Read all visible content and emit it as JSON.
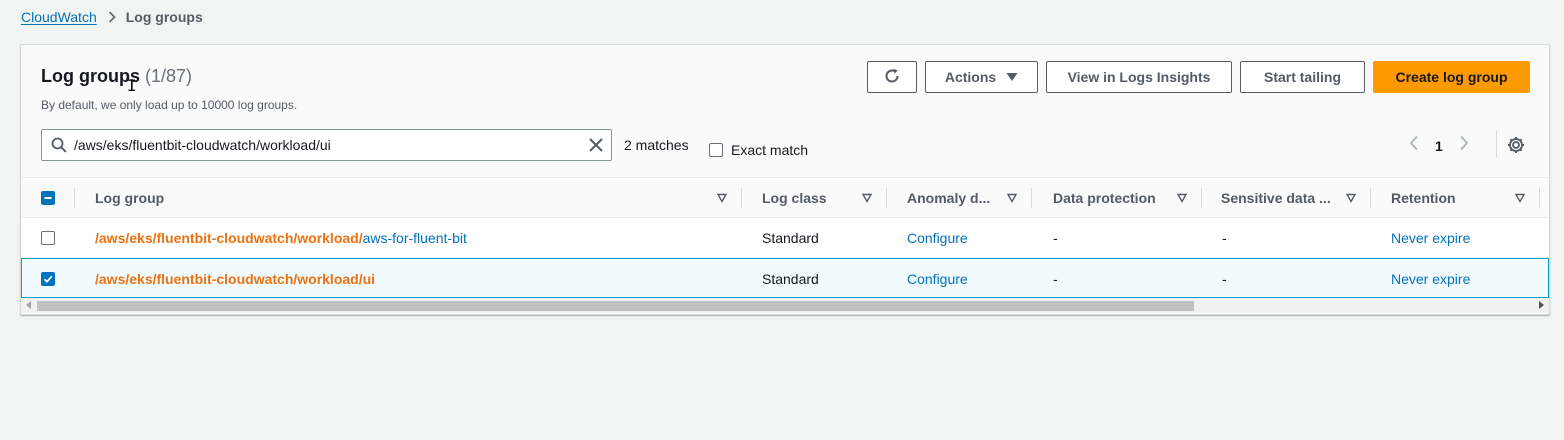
{
  "breadcrumb": {
    "parent": "CloudWatch",
    "current": "Log groups"
  },
  "header": {
    "title": "Log groups",
    "count": "(1/87)",
    "subtitle": "By default, we only load up to 10000 log groups."
  },
  "toolbar": {
    "actions_label": "Actions",
    "insights_label": "View in Logs Insights",
    "tail_label": "Start tailing",
    "create_label": "Create log group"
  },
  "search": {
    "value": "/aws/eks/fluentbit-cloudwatch/workload/ui",
    "matches": "2 matches",
    "exact_match_label": "Exact match",
    "exact_match_checked": false
  },
  "pagination": {
    "page": "1"
  },
  "table": {
    "columns": [
      "Log group",
      "Log class",
      "Anomaly d...",
      "Data protection",
      "Sensitive data ...",
      "Retention"
    ],
    "rows": [
      {
        "log_group_prefix": "/aws/eks/fluentbit-cloudwatch/workload/",
        "log_group_suffix": "aws-for-fluent-bit",
        "log_class": "Standard",
        "anomaly": "Configure",
        "data_protection": "-",
        "sensitive": "-",
        "retention": "Never expire",
        "selected": false
      },
      {
        "log_group_prefix": "/aws/eks/fluentbit-cloudwatch/workload/ui",
        "log_group_suffix": "",
        "log_class": "Standard",
        "anomaly": "Configure",
        "data_protection": "-",
        "sensitive": "-",
        "retention": "Never expire",
        "selected": true
      }
    ]
  },
  "colors": {
    "accent": "#ff9900",
    "link": "#0073bb",
    "match_highlight": "#ec7211",
    "selected_row": "#f1faff"
  }
}
